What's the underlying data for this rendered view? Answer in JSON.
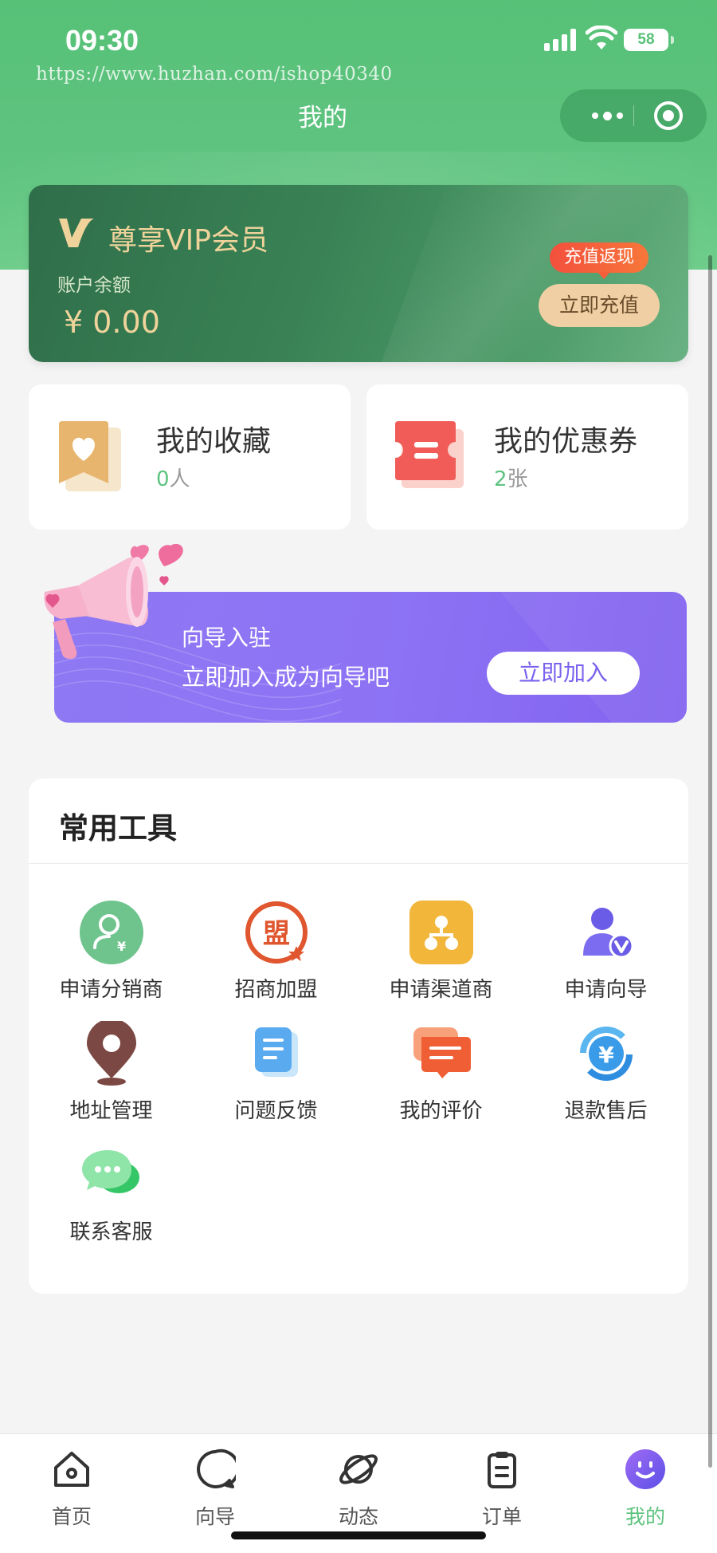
{
  "status_bar": {
    "time": "09:30",
    "battery": "58"
  },
  "watermark": "https://www.huzhan.com/ishop40340",
  "nav": {
    "title": "我的"
  },
  "vip": {
    "title": "尊享VIP会员",
    "balance_label": "账户余额",
    "balance_value": "¥ 0.00",
    "tag": "充值返现",
    "button": "立即充值"
  },
  "stats": {
    "favorites": {
      "title": "我的收藏",
      "count": "0",
      "unit": "人"
    },
    "coupons": {
      "title": "我的优惠券",
      "count": "2",
      "unit": "张"
    }
  },
  "guide_banner": {
    "title": "向导入驻",
    "subtitle": "立即加入成为向导吧",
    "button": "立即加入"
  },
  "tools": {
    "title": "常用工具",
    "items": [
      {
        "label": "申请分销商",
        "icon": "distributor-icon"
      },
      {
        "label": "招商加盟",
        "icon": "franchise-icon"
      },
      {
        "label": "申请渠道商",
        "icon": "channel-icon"
      },
      {
        "label": "申请向导",
        "icon": "guide-apply-icon"
      },
      {
        "label": "地址管理",
        "icon": "location-pin-icon"
      },
      {
        "label": "问题反馈",
        "icon": "feedback-doc-icon"
      },
      {
        "label": "我的评价",
        "icon": "review-chat-icon"
      },
      {
        "label": "退款售后",
        "icon": "refund-icon"
      },
      {
        "label": "联系客服",
        "icon": "customer-service-icon"
      }
    ]
  },
  "tabbar": {
    "items": [
      {
        "label": "首页",
        "icon": "home-icon"
      },
      {
        "label": "向导",
        "icon": "guide-chat-icon"
      },
      {
        "label": "动态",
        "icon": "planet-icon"
      },
      {
        "label": "订单",
        "icon": "clipboard-icon"
      },
      {
        "label": "我的",
        "icon": "profile-face-icon",
        "active": true
      }
    ]
  },
  "colors": {
    "primary": "#5ec37f",
    "vip_gold": "#efd39b",
    "banner_purple": "#8d73f4"
  }
}
